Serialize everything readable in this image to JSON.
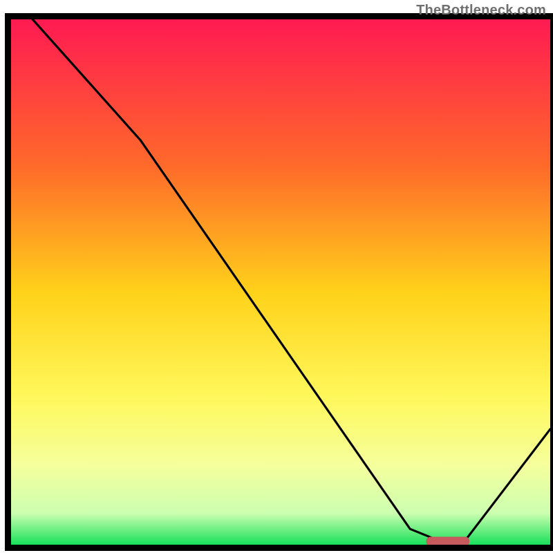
{
  "watermark": "TheBottleneck.com",
  "chart_data": {
    "type": "line",
    "title": "",
    "xlabel": "",
    "ylabel": "",
    "xlim": [
      0,
      100
    ],
    "ylim": [
      0,
      100
    ],
    "series": [
      {
        "name": "bottleneck-curve",
        "x": [
          4,
          24,
          74,
          80,
          84,
          100
        ],
        "y": [
          100,
          77,
          3,
          0.5,
          0.5,
          22
        ]
      }
    ],
    "marker": {
      "name": "optimal-range",
      "x_start": 77,
      "x_end": 85,
      "y": 0.6
    },
    "gradient_bands": [
      {
        "y_pct": 0,
        "color": "#ff1a52"
      },
      {
        "y_pct": 28,
        "color": "#ff6a2a"
      },
      {
        "y_pct": 52,
        "color": "#ffd21a"
      },
      {
        "y_pct": 72,
        "color": "#fff85c"
      },
      {
        "y_pct": 85,
        "color": "#f5ff9d"
      },
      {
        "y_pct": 94,
        "color": "#ccffb0"
      },
      {
        "y_pct": 100,
        "color": "#18e05a"
      }
    ],
    "frame": {
      "inner_left": 16,
      "inner_top": 28,
      "inner_right": 796,
      "inner_bottom": 788,
      "stroke": "#000000",
      "stroke_width": 9
    }
  }
}
